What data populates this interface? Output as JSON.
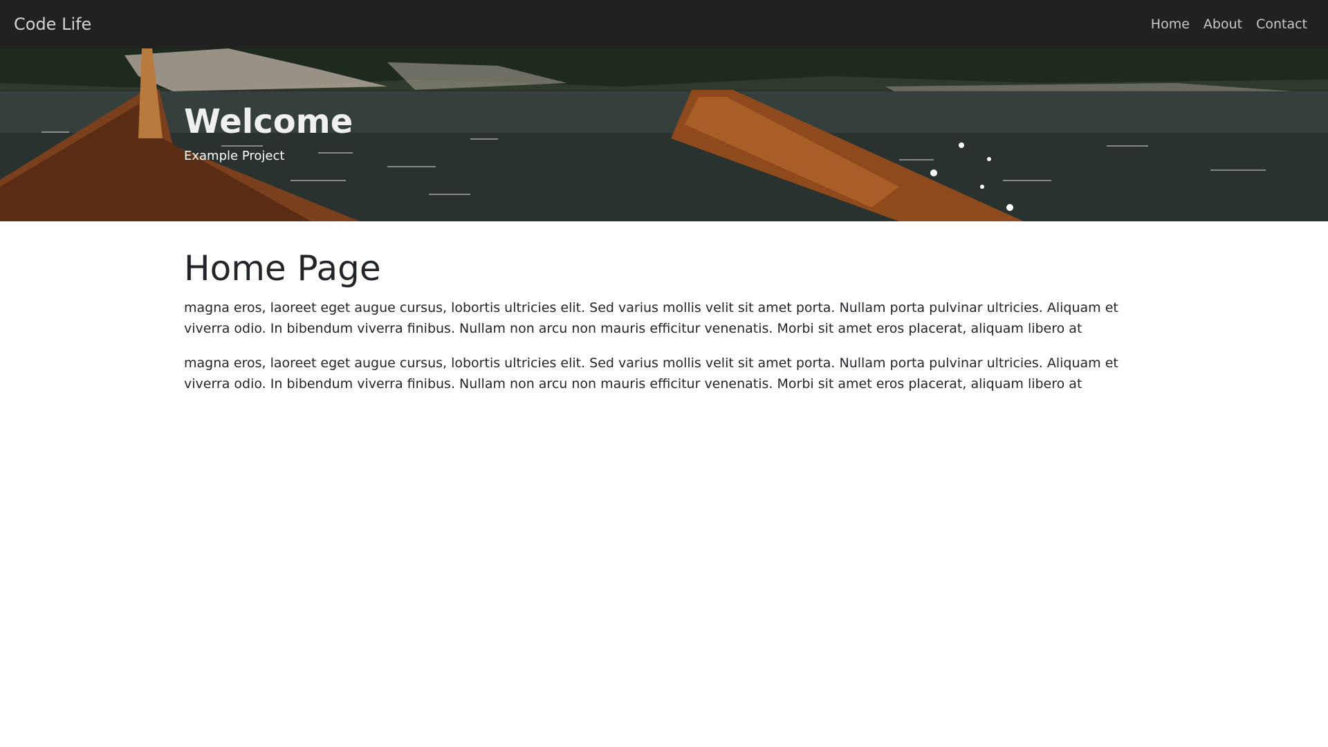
{
  "navbar": {
    "brand": "Code Life",
    "links": [
      "Home",
      "About",
      "Contact"
    ]
  },
  "hero": {
    "title": "Welcome",
    "subtitle": "Example Project"
  },
  "main": {
    "title": "Home Page",
    "paragraphs": [
      "magna eros, laoreet eget augue cursus, lobortis ultricies elit. Sed varius mollis velit sit amet porta. Nullam porta pulvinar ultricies. Aliquam et viverra odio. In bibendum viverra finibus. Nullam non arcu non mauris efficitur venenatis. Morbi sit amet eros placerat, aliquam libero at",
      "magna eros, laoreet eget augue cursus, lobortis ultricies elit. Sed varius mollis velit sit amet porta. Nullam porta pulvinar ultricies. Aliquam et viverra odio. In bibendum viverra finibus. Nullam non arcu non mauris efficitur venenatis. Morbi sit amet eros placerat, aliquam libero at"
    ]
  },
  "colors": {
    "navbar_bg": "#212121",
    "text_dark": "#212529",
    "nav_text": "#c9c9c9"
  }
}
